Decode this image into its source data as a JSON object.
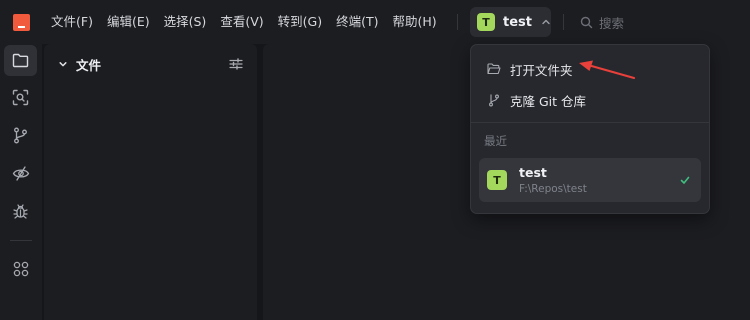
{
  "menubar": {
    "items": [
      "文件(F)",
      "编辑(E)",
      "选择(S)",
      "查看(V)",
      "转到(G)",
      "终端(T)",
      "帮助(H)"
    ],
    "workspace": {
      "avatar_letter": "T",
      "name": "test"
    },
    "search": {
      "placeholder": "搜索"
    }
  },
  "sidebar_panel": {
    "title": "文件"
  },
  "workspace_menu": {
    "actions": [
      {
        "label": "打开文件夹",
        "icon": "folder-open-icon"
      },
      {
        "label": "克隆 Git 仓库",
        "icon": "git-branch-icon"
      }
    ],
    "recent_heading": "最近",
    "recent": [
      {
        "avatar_letter": "T",
        "name": "test",
        "path": "F:\\Repos\\test",
        "selected": true
      }
    ]
  },
  "activity_bar": {
    "items": [
      "files-icon",
      "scan-search-icon",
      "source-control-icon",
      "preview-icon",
      "debug-icon",
      "extensions-icon"
    ],
    "active": "files-icon"
  },
  "colors": {
    "accent_avatar": "#a3d85c",
    "logo": "#f15a3c",
    "annotation_arrow": "#e8403a",
    "check": "#3fbf7f"
  }
}
